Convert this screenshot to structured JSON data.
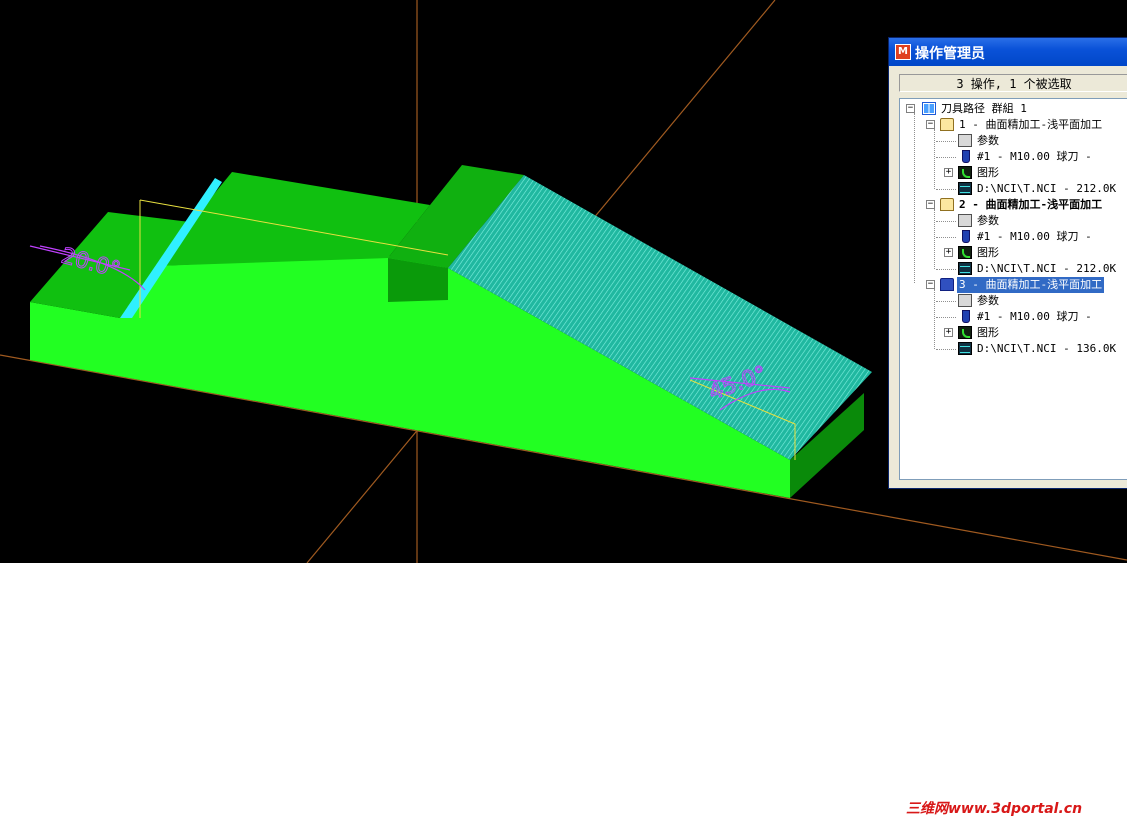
{
  "viewport": {
    "background": "#000000",
    "model_color": "#22ff22",
    "surface_color": "#30d8c0",
    "axis_color": "#a05a20",
    "dimension_color": "#c040ff",
    "dim_left": "20.0°",
    "dim_right": "45.0°"
  },
  "operations_manager": {
    "title": "操作管理员",
    "app_icon": "mastercam-icon",
    "status": "3 操作, 1 个被选取",
    "tree": {
      "root": {
        "label": "刀具路径 群組 1",
        "icon": "toolpath-group-icon"
      },
      "operations": [
        {
          "label": "1 - 曲面精加工-浅平面加工",
          "bold": false,
          "selected": false,
          "children": {
            "params": "参数",
            "tool": "#1 - M10.00 球刀 -",
            "geometry": "图形",
            "nci": "D:\\NCI\\T.NCI - 212.0K"
          }
        },
        {
          "label": "2 - 曲面精加工-浅平面加工",
          "bold": true,
          "selected": false,
          "children": {
            "params": "参数",
            "tool": "#1 - M10.00 球刀 -",
            "geometry": "图形",
            "nci": "D:\\NCI\\T.NCI - 212.0K"
          }
        },
        {
          "label": "3 - 曲面精加工-浅平面加工",
          "bold": false,
          "selected": true,
          "children": {
            "params": "参数",
            "tool": "#1 - M10.00 球刀 -",
            "geometry": "图形",
            "nci": "D:\\NCI\\T.NCI - 136.0K"
          }
        }
      ]
    }
  },
  "watermark": "三维网www.3dportal.cn"
}
